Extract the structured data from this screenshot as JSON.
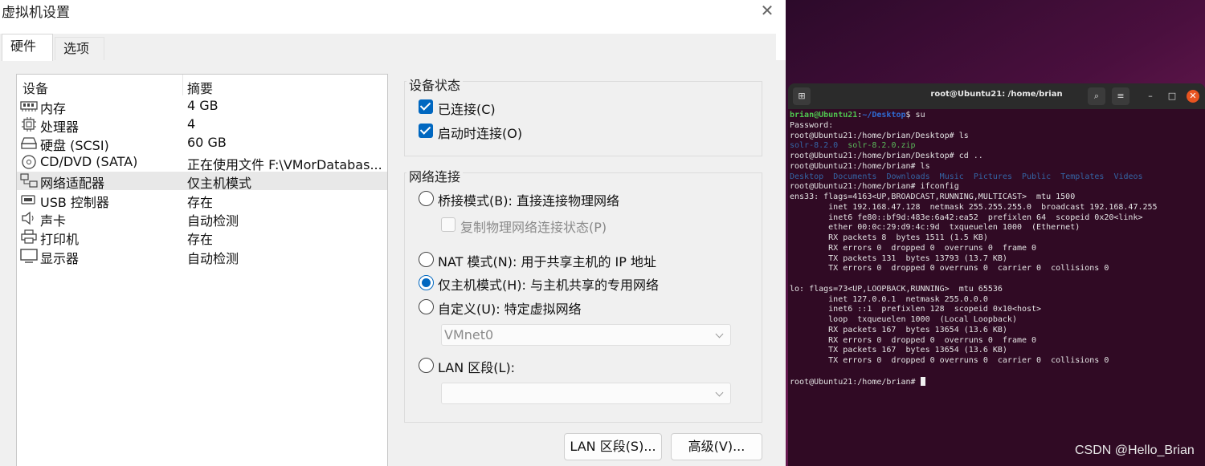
{
  "dialog": {
    "title": "虚拟机设置",
    "tabs": [
      {
        "label": "硬件"
      },
      {
        "label": "选项"
      }
    ],
    "device_list": {
      "header_device": "设备",
      "header_summary": "摘要",
      "rows": [
        {
          "name": "内存",
          "summary": "4 GB",
          "icon": "memory-icon"
        },
        {
          "name": "处理器",
          "summary": "4",
          "icon": "processor-icon"
        },
        {
          "name": "硬盘 (SCSI)",
          "summary": "60 GB",
          "icon": "harddisk-icon"
        },
        {
          "name": "CD/DVD (SATA)",
          "summary": "正在使用文件 F:\\VMorDatabas...",
          "icon": "cd-dvd-icon"
        },
        {
          "name": "网络适配器",
          "summary": "仅主机模式",
          "icon": "network-adapter-icon",
          "selected": true
        },
        {
          "name": "USB 控制器",
          "summary": "存在",
          "icon": "usb-icon"
        },
        {
          "name": "声卡",
          "summary": "自动检测",
          "icon": "sound-card-icon"
        },
        {
          "name": "打印机",
          "summary": "存在",
          "icon": "printer-icon"
        },
        {
          "name": "显示器",
          "summary": "自动检测",
          "icon": "display-icon"
        }
      ]
    },
    "device_status": {
      "title": "设备状态",
      "connected": "已连接(C)",
      "connect_at_power_on": "启动时连接(O)"
    },
    "network": {
      "title": "网络连接",
      "bridged": "桥接模式(B): 直接连接物理网络",
      "replicate": "复制物理网络连接状态(P)",
      "nat": "NAT 模式(N): 用于共享主机的 IP 地址",
      "host_only": "仅主机模式(H): 与主机共享的专用网络",
      "custom": "自定义(U): 特定虚拟网络",
      "custom_value": "VMnet0",
      "lan_segment": "LAN 区段(L):",
      "lan_value": "",
      "selected": "host_only"
    },
    "buttons": {
      "lan_segments": "LAN 区段(S)...",
      "advanced": "高级(V)..."
    }
  },
  "terminal": {
    "title": "root@Ubuntu21: /home/brian",
    "lines": [
      "brian@Ubuntu21:~/Desktop$ su",
      "Password:",
      "root@Ubuntu21:/home/brian/Desktop# ls",
      "solr-8.2.0  solr-8.2.0.zip",
      "root@Ubuntu21:/home/brian/Desktop# cd ..",
      "root@Ubuntu21:/home/brian# ls",
      "Desktop  Documents  Downloads  Music  Pictures  Public  Templates  Videos",
      "root@Ubuntu21:/home/brian# ifconfig",
      "ens33: flags=4163<UP,BROADCAST,RUNNING,MULTICAST>  mtu 1500",
      "        inet 192.168.47.128  netmask 255.255.255.0  broadcast 192.168.47.255",
      "        inet6 fe80::bf9d:483e:6a42:ea52  prefixlen 64  scopeid 0x20<link>",
      "        ether 00:0c:29:d9:4c:9d  txqueuelen 1000  (Ethernet)",
      "        RX packets 8  bytes 1511 (1.5 KB)",
      "        RX errors 0  dropped 0  overruns 0  frame 0",
      "        TX packets 131  bytes 13793 (13.7 KB)",
      "        TX errors 0  dropped 0 overruns 0  carrier 0  collisions 0",
      "",
      "lo: flags=73<UP,LOOPBACK,RUNNING>  mtu 65536",
      "        inet 127.0.0.1  netmask 255.0.0.0",
      "        inet6 ::1  prefixlen 128  scopeid 0x10<host>",
      "        loop  txqueuelen 1000  (Local Loopback)",
      "        RX packets 167  bytes 13654 (13.6 KB)",
      "        RX errors 0  dropped 0  overruns 0  frame 0",
      "        TX packets 167  bytes 13654 (13.6 KB)",
      "        TX errors 0  dropped 0 overruns 0  carrier 0  collisions 0",
      "",
      "root@Ubuntu21:/home/brian# "
    ]
  },
  "watermark": "CSDN @Hello_Brian",
  "colors": {
    "accent": "#0067c0",
    "terminal_bg": "#300a24",
    "ubuntu_orange": "#e95420"
  }
}
